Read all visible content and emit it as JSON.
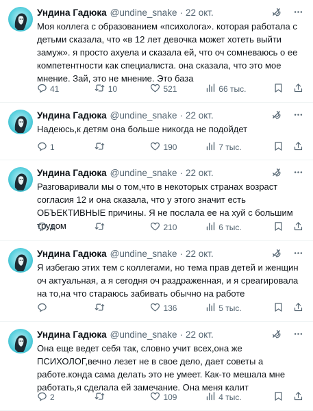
{
  "tweets": [
    {
      "name": "Ундина Гадюка",
      "handle": "@undine_snake",
      "sep": "·",
      "time": "22 окт.",
      "text": "Моя коллега с образованием «психолога». которая работала с детьми сказала, что «в 12 лет девочка может хотеть выйти замуж». я просто ахуела и сказала ей, что оч сомневаюсь о ее компетентности как специалиста. она сказала, что это мое мнение. Зай, это не мнение. Это база",
      "replies": "41",
      "retweets": "10",
      "likes": "521",
      "views": "66 тыс."
    },
    {
      "name": "Ундина Гадюка",
      "handle": "@undine_snake",
      "sep": "·",
      "time": "22 окт.",
      "text": "Надеюсь,к детям она больше никогда не подойдет",
      "replies": "1",
      "retweets": "",
      "likes": "190",
      "views": "7 тыс."
    },
    {
      "name": "Ундина Гадюка",
      "handle": "@undine_snake",
      "sep": "·",
      "time": "22 окт.",
      "text": "Разговаривали мы о том,что в некоторых странах возраст согласия 12 и она сказала, что у этого значит есть ОБЪЕКТИВНЫЕ причины. Я не послала ее на хуй с большим трудом",
      "replies": "1",
      "retweets": "",
      "likes": "210",
      "views": "6 тыс."
    },
    {
      "name": "Ундина Гадюка",
      "handle": "@undine_snake",
      "sep": "·",
      "time": "22 окт.",
      "text": "Я избегаю этих тем с коллегами, но тема прав детей и женщин оч актуальная, а я сегодня оч раздраженная, и я среагировала на то,на что стараюсь забивать обычно на работе",
      "replies": "",
      "retweets": "",
      "likes": "136",
      "views": "5 тыс."
    },
    {
      "name": "Ундина Гадюка",
      "handle": "@undine_snake",
      "sep": "·",
      "time": "22 окт.",
      "text": "Она еще ведет себя так, словно учит всех,она же ПСИХОЛОГ,вечно лезет не в свое дело, дает советы а работе.конда сама делать это не умеет. Как-то мешала мне работать,я сделала ей замечание. Она меня калит",
      "replies": "2",
      "retweets": "",
      "likes": "109",
      "views": "4 тыс."
    }
  ],
  "icons": {
    "grok": "grok-icon",
    "more": "more-icon",
    "reply": "reply-icon",
    "retweet": "retweet-icon",
    "like": "like-icon",
    "views": "views-icon",
    "bookmark": "bookmark-icon",
    "share": "share-icon"
  },
  "colors": {
    "text": "#0f1419",
    "secondary": "#536471",
    "divider": "#eff3f4",
    "avatar": "#59d0de"
  }
}
